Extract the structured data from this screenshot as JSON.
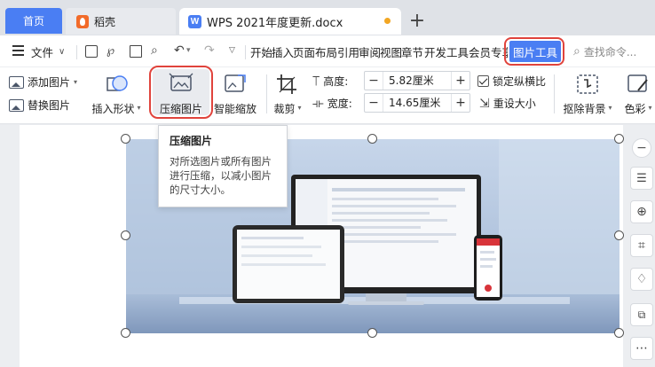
{
  "tabs": {
    "home": "首页",
    "daoke": "稻壳",
    "document": "WPS 2021年度更新.docx",
    "add": "+"
  },
  "menu": {
    "file": "文件",
    "items": [
      "开始",
      "插入",
      "页面布局",
      "引用",
      "审阅",
      "视图",
      "章节",
      "开发工具",
      "会员专享"
    ],
    "picture_tools": "图片工具",
    "search_placeholder": "查找命令..."
  },
  "ribbon": {
    "add_picture": "添加图片",
    "replace_picture": "替换图片",
    "insert_shape": "插入形状",
    "compress_picture": "压缩图片",
    "smart_zoom": "智能缩放",
    "crop": "裁剪",
    "height_label": "高度:",
    "height_value": "5.82厘米",
    "width_label": "宽度:",
    "width_value": "14.65厘米",
    "lock_ratio": "锁定纵横比",
    "reset_size": "重设大小",
    "remove_bg": "抠除背景",
    "color": "色彩"
  },
  "tooltip": {
    "title": "压缩图片",
    "body": "对所选图片或所有图片进行压缩，以减小图片的尺寸大小。"
  },
  "colors": {
    "accent": "#4a7ef3",
    "highlight_ring": "#e0433c",
    "modified_dot": "#f2a623"
  }
}
